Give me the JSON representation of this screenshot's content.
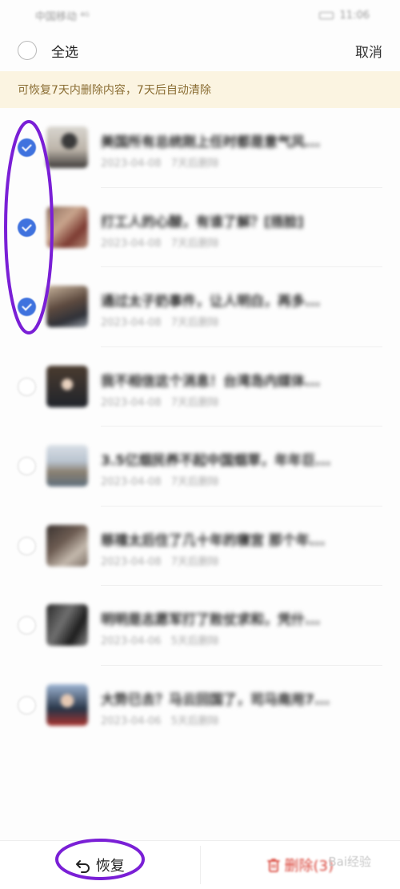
{
  "status_bar": {
    "carrier": "中国移动 ⁴ᴳ",
    "time": "11:06"
  },
  "top_bar": {
    "select_all_label": "全选",
    "cancel_label": "取消"
  },
  "notice": {
    "text": "可恢复7天内删除内容，7天后自动清除"
  },
  "items": [
    {
      "title": "美国所有总统刚上任时都是意气风...",
      "date": "2023-04-08",
      "remain": "7天后删除",
      "checked": true
    },
    {
      "title": "打工人的心酸，有谁了解？[捂脸]",
      "date": "2023-04-08",
      "remain": "7天后删除",
      "checked": true
    },
    {
      "title": "通过太子奶事件，让人明白，再多...",
      "date": "2023-04-08",
      "remain": "7天后删除",
      "checked": true
    },
    {
      "title": "我不相信这个消息！台湾岛内媒体...",
      "date": "2023-04-08",
      "remain": "7天后删除",
      "checked": false
    },
    {
      "title": "3.5亿烟民养不起中国烟草，年年巨...",
      "date": "2023-04-08",
      "remain": "7天后删除",
      "checked": false
    },
    {
      "title": "慈禧太后住了几十年的寝宫 那个年...",
      "date": "2023-04-08",
      "remain": "7天后删除",
      "checked": false
    },
    {
      "title": "明明是志愿军打了败仗求和，凭什...",
      "date": "2023-04-06",
      "remain": "5天后删除",
      "checked": false
    },
    {
      "title": "大势已去？马云回国了，司马南用7...",
      "date": "2023-04-06",
      "remain": "5天后删除",
      "checked": false
    }
  ],
  "bottom_bar": {
    "restore_label": "恢复",
    "delete_label": "删除(3)"
  },
  "colors": {
    "accent": "#3f72de",
    "delete": "#d9453a",
    "notice_bg": "#fbf4e1",
    "annotation": "#7a1fd6"
  }
}
